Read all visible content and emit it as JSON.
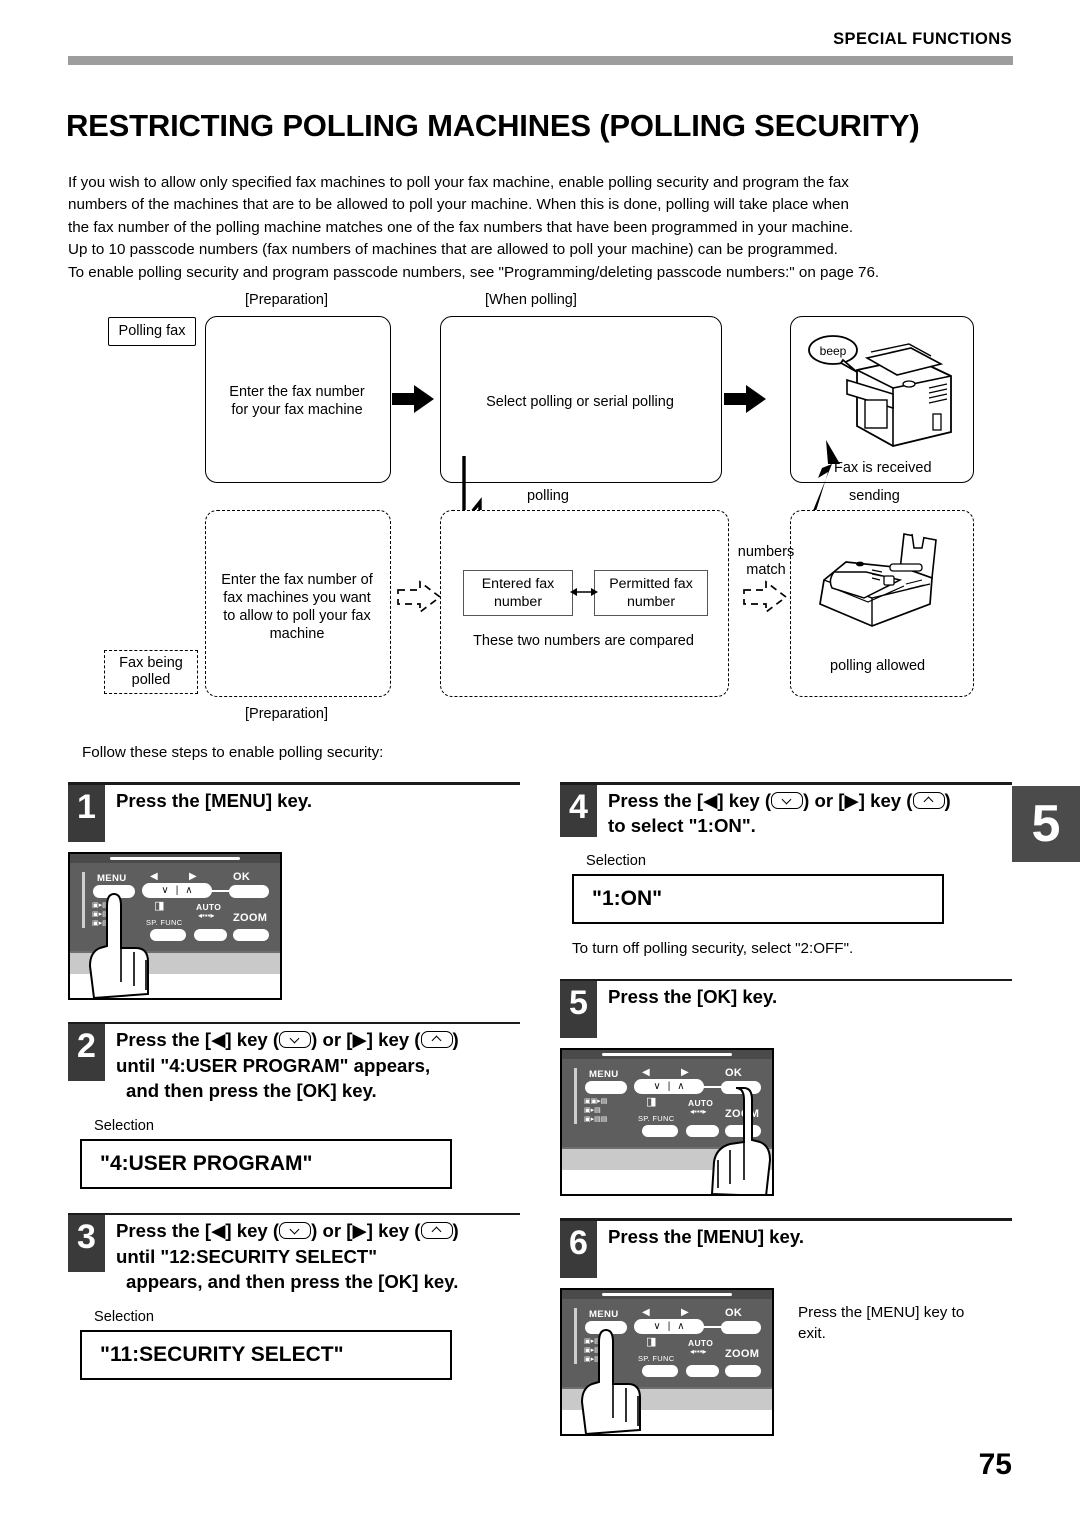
{
  "header": {
    "section_label": "SPECIAL FUNCTIONS",
    "title": "RESTRICTING POLLING MACHINES (POLLING SECURITY)"
  },
  "intro": {
    "line1": "If you wish to allow only specified fax machines to poll your fax machine, enable polling security and program the fax",
    "line2": "numbers of the machines that are to be allowed to poll your machine. When this is done, polling will take place when",
    "line3": "the fax number of the polling machine matches one of the fax numbers that have been programmed in your machine.",
    "line4": "Up to 10 passcode numbers (fax numbers of machines that are allowed to poll your machine) can be programmed.",
    "line5": "To enable polling security and program passcode numbers, see \"Programming/deleting passcode numbers:\" on page 76."
  },
  "diagram": {
    "caption_preparation_top": "[Preparation]",
    "caption_when_polling": "[When polling]",
    "caption_preparation_bottom": "[Preparation]",
    "tag_polling_fax": "Polling fax",
    "tag_fax_being_polled": "Fax being\npolled",
    "box_enter_own": "Enter the fax number\nfor your fax machine",
    "box_select_polling": "Select polling or serial polling",
    "box_enter_allowed": "Enter the fax number of\nfax machines you want\nto allow to poll your fax\nmachine",
    "label_polling": "polling",
    "label_sending": "sending",
    "label_numbers_match": "numbers\nmatch",
    "cmp_entered": "Entered fax\nnumber",
    "cmp_permitted": "Permitted fax\nnumber",
    "cmp_caption": "These two numbers are compared",
    "beep": "beep",
    "fax_received": "Fax is received",
    "polling_allowed": "polling allowed"
  },
  "follow_line": "Follow these steps to enable polling security:",
  "side_tab": "5",
  "steps": [
    {
      "num": "1",
      "line1": "Press the [MENU] key.",
      "line2": "",
      "line3": ""
    },
    {
      "num": "2",
      "pre": "Press the [",
      "mid1": "] key (",
      "mid2": ") or [",
      "mid3": "] key (",
      "post": ")",
      "line2": "until \"4:USER PROGRAM\" appears,",
      "line3": "and then press the [OK] key.",
      "selection_label": "Selection",
      "selection_value": "\"4:USER PROGRAM\""
    },
    {
      "num": "3",
      "line2": "until \"12:SECURITY SELECT\"",
      "line3": "appears, and then press the [OK] key.",
      "selection_label": "Selection",
      "selection_value": "\"11:SECURITY SELECT\""
    },
    {
      "num": "4",
      "line2": "to select \"1:ON\".",
      "selection_label": "Selection",
      "selection_value": "\"1:ON\"",
      "note": "To turn off polling security, select \"2:OFF\"."
    },
    {
      "num": "5",
      "line1": "Press the [OK] key."
    },
    {
      "num": "6",
      "line1": "Press the [MENU] key.",
      "exit_note": "Press the [MENU] key to\nexit."
    }
  ],
  "panel": {
    "menu": "MENU",
    "ok": "OK",
    "zoom": "ZOOM",
    "auto": "AUTO",
    "sp_func": "SP. FUNC",
    "left_arrow": "◀",
    "right_arrow": "▶",
    "down_chevron": "∨",
    "up_chevron": "∧",
    "divider": "|"
  },
  "page_number": "75"
}
